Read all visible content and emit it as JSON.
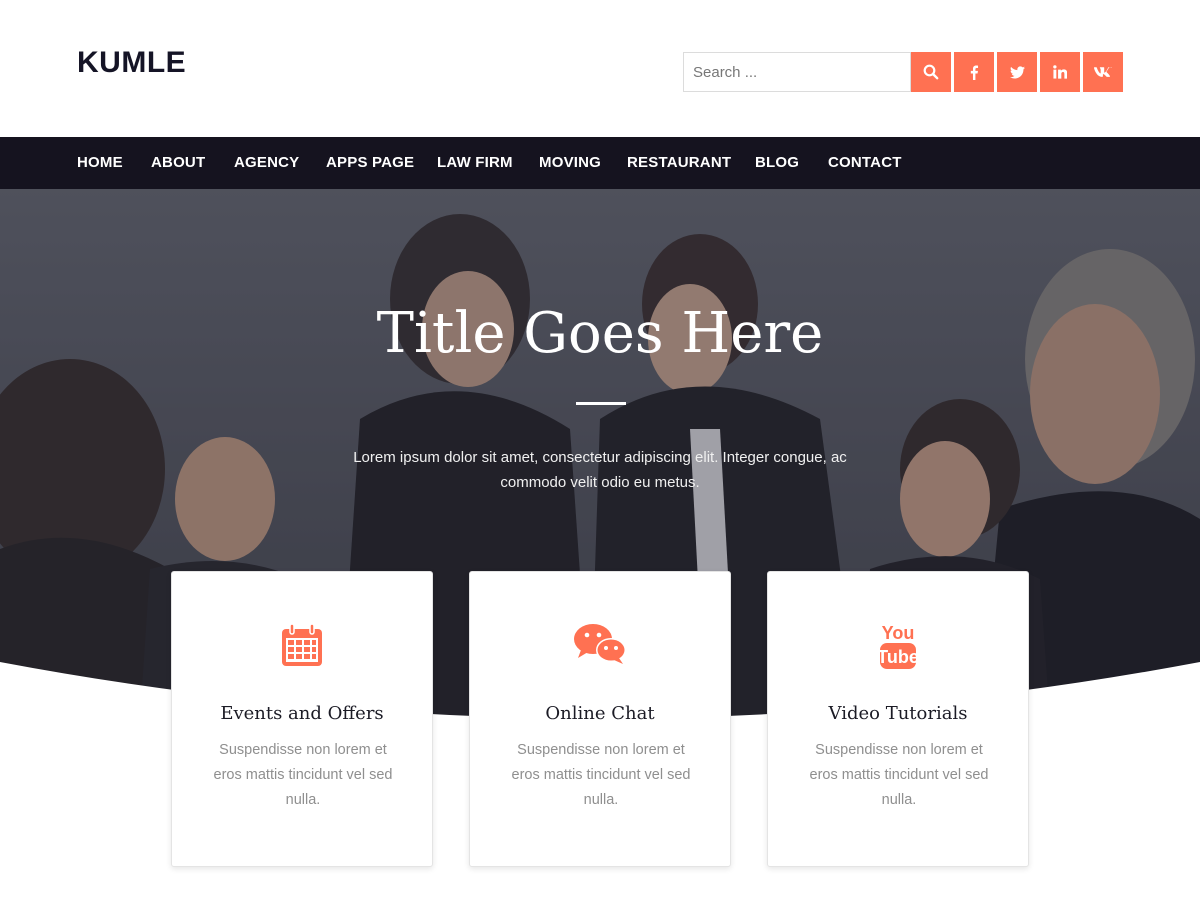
{
  "site": {
    "logo": "KUMLE"
  },
  "header": {
    "search_placeholder": "Search ...",
    "search_button_icon": "search-icon",
    "social": [
      {
        "name": "facebook-icon",
        "glyph": "f"
      },
      {
        "name": "twitter-icon",
        "glyph": ""
      },
      {
        "name": "linkedin-icon",
        "glyph": "in"
      },
      {
        "name": "vk-icon",
        "glyph": ""
      }
    ]
  },
  "nav": {
    "items": [
      "HOME",
      "ABOUT",
      "AGENCY",
      "APPS PAGE",
      "LAW FIRM",
      "MOVING",
      "RESTAURANT",
      "BLOG",
      "CONTACT"
    ]
  },
  "hero": {
    "title": "Title Goes Here",
    "text": "Lorem ipsum dolor sit amet, consectetur adipiscing elit. Integer congue, ac commodo velit odio eu metus."
  },
  "cards": [
    {
      "icon": "calendar-icon",
      "title": "Events and Offers",
      "text": "Suspendisse non lorem et eros mattis tincidunt vel sed nulla."
    },
    {
      "icon": "chat-icon",
      "title": "Online Chat",
      "text": "Suspendisse non lorem et eros mattis tincidunt vel sed nulla."
    },
    {
      "icon": "youtube-icon",
      "title": "Video Tutorials",
      "text": "Suspendisse non lorem et eros mattis tincidunt vel sed nulla."
    }
  ],
  "colors": {
    "accent": "#ff7152",
    "nav_bg": "#15131f",
    "text_muted": "#8f8f8f"
  }
}
